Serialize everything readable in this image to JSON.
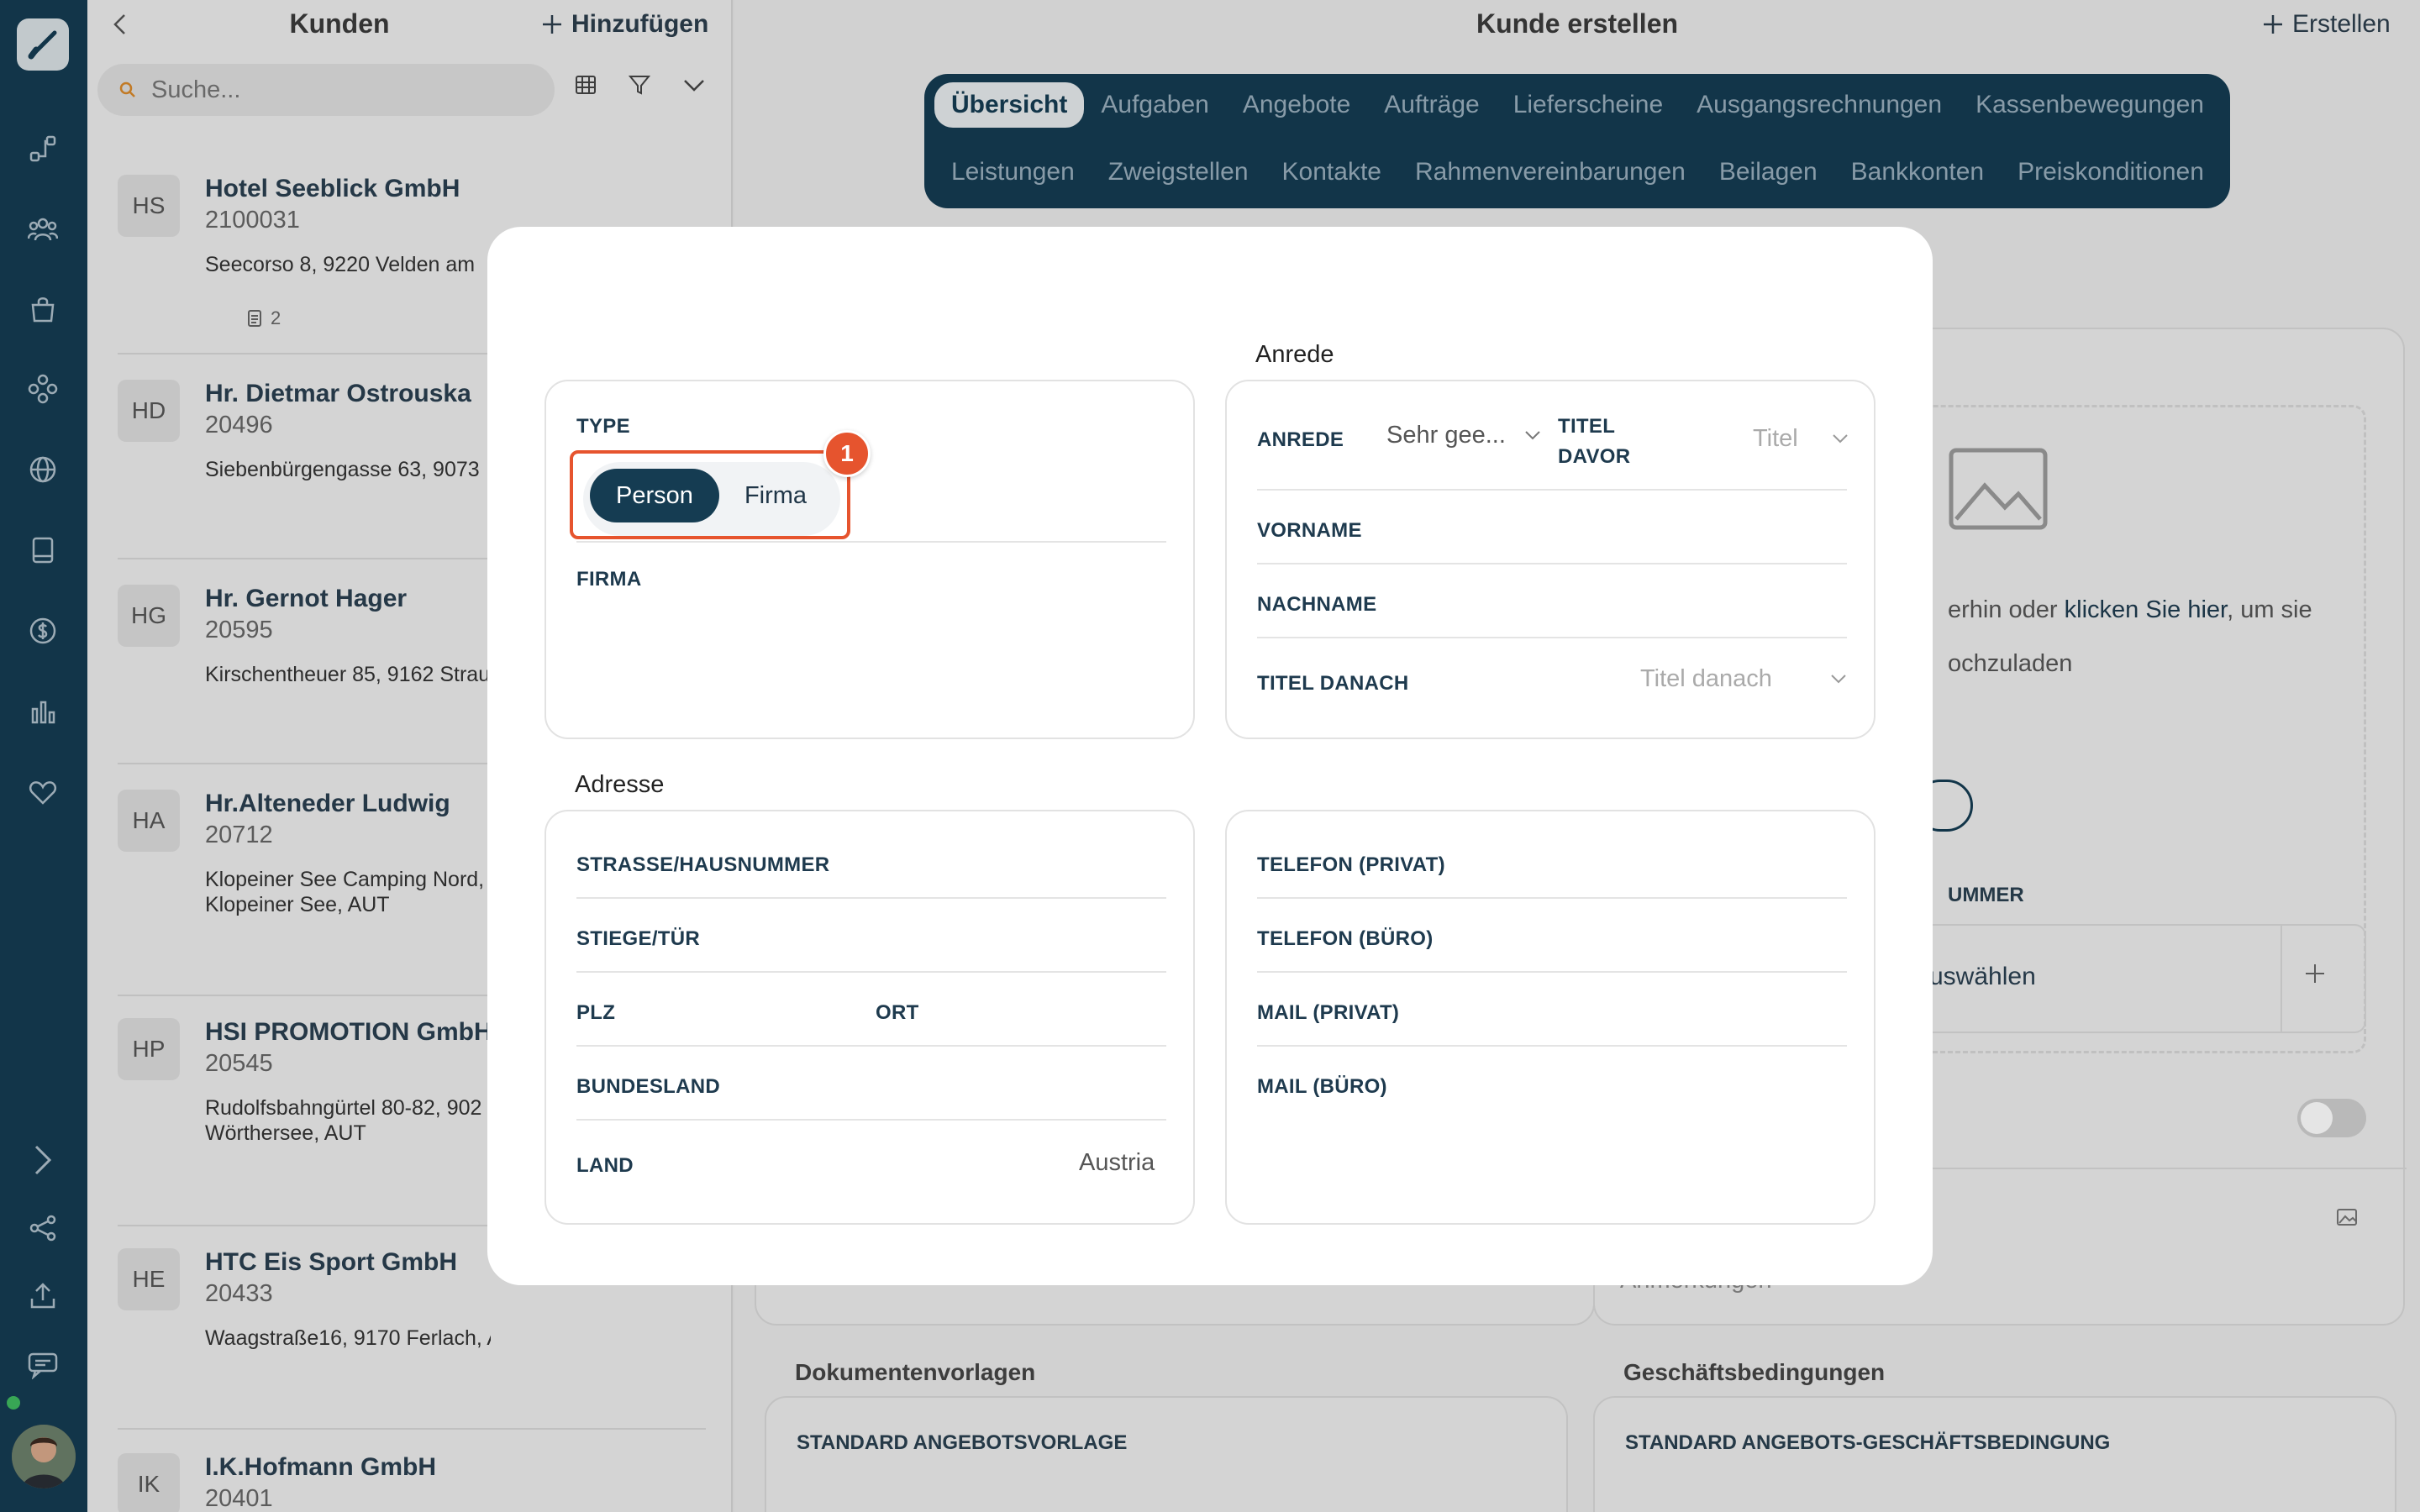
{
  "list": {
    "title": "Kunden",
    "add_label": "Hinzufügen",
    "search_placeholder": "Suche...",
    "customers": [
      {
        "initials": "HS",
        "name": "Hotel Seeblick GmbH",
        "number": "2100031",
        "address": "Seecorso 8, 9220 Velden am",
        "docs": "2"
      },
      {
        "initials": "HD",
        "name": "Hr. Dietmar Ostrouska",
        "number": "20496",
        "address": "Siebenbürgengasse 63, 9073"
      },
      {
        "initials": "HG",
        "name": "Hr. Gernot Hager",
        "number": "20595",
        "address": "Kirschentheuer 85, 9162 Strau"
      },
      {
        "initials": "HA",
        "name": "Hr.Alteneder Ludwig",
        "number": "20712",
        "address": "Klopeiner See Camping Nord, Klopeiner See, AUT"
      },
      {
        "initials": "HP",
        "name": "HSI PROMOTION GmbH",
        "number": "20545",
        "address": "Rudolfsbahngürtel 80-82, 902 Wörthersee, AUT"
      },
      {
        "initials": "HE",
        "name": "HTC Eis Sport GmbH",
        "number": "20433",
        "address": "Waagstraße16, 9170 Ferlach, AUT"
      },
      {
        "initials": "IK",
        "name": "I.K.Hofmann GmbH",
        "number": "20401",
        "address": ""
      }
    ]
  },
  "main": {
    "title": "Kunde erstellen",
    "create_label": "Erstellen",
    "tabs_row1": [
      "Übersicht",
      "Aufgaben",
      "Angebote",
      "Aufträge",
      "Lieferscheine",
      "Ausgangsrechnungen",
      "Kassenbewegungen"
    ],
    "tabs_row2": [
      "Leistungen",
      "Zweigstellen",
      "Kontakte",
      "Rahmenvereinbarungen",
      "Beilagen",
      "Bankkonten",
      "Preiskonditionen"
    ],
    "upload_text_1": "erhin oder ",
    "upload_link": "klicken Sie hier",
    "upload_text_2": ", um sie",
    "upload_text_3": "ochzuladen",
    "field_partial": "UMMER",
    "select_partial": "uswählen",
    "notes_partial": "Anmerkungen",
    "doc_templates": "Dokumentenvorlagen",
    "terms": "Geschäftsbedingungen",
    "std_offer_template": "STANDARD ANGEBOTSVORLAGE",
    "std_offer_terms": "STANDARD ANGEBOTS-GESCHÄFTSBEDINGUNG"
  },
  "modal": {
    "type_label": "TYPE",
    "type_options": [
      "Person",
      "Firma"
    ],
    "type_selected": "Person",
    "firma_label": "FIRMA",
    "anrede_section": "Anrede",
    "anrede_label": "ANREDE",
    "anrede_value": "Sehr gee...",
    "titel_davor_label": [
      "TITEL",
      "DAVOR"
    ],
    "titel_placeholder": "Titel",
    "vorname_label": "VORNAME",
    "nachname_label": "NACHNAME",
    "titel_danach_label": "TITEL DANACH",
    "titel_danach_placeholder": "Titel danach",
    "adresse_section": "Adresse",
    "strasse_label": "STRASSE/HAUSNUMMER",
    "stiege_label": "STIEGE/TÜR",
    "plz_label": "PLZ",
    "ort_label": "ORT",
    "bundesland_label": "BUNDESLAND",
    "land_label": "LAND",
    "land_value": "Austria",
    "telefon_privat_label": "TELEFON (PRIVAT)",
    "telefon_buero_label": "TELEFON (BÜRO)",
    "mail_privat_label": "MAIL (PRIVAT)",
    "mail_buero_label": "MAIL (BÜRO)",
    "step_badge": "1"
  },
  "colors": {
    "primary": "#153c52",
    "highlight": "#e6542e"
  },
  "icons": [
    "logo-icon",
    "workflow-icon",
    "users-icon",
    "bag-icon",
    "modules-icon",
    "globe-icon",
    "book-icon",
    "dollar-icon",
    "chart-icon",
    "heart-icon",
    "chevron-right-icon",
    "share-icon",
    "upload-icon",
    "chat-icon",
    "back-icon",
    "plus-icon",
    "search-icon",
    "table-icon",
    "filter-icon",
    "chevron-down-icon",
    "image-icon"
  ]
}
